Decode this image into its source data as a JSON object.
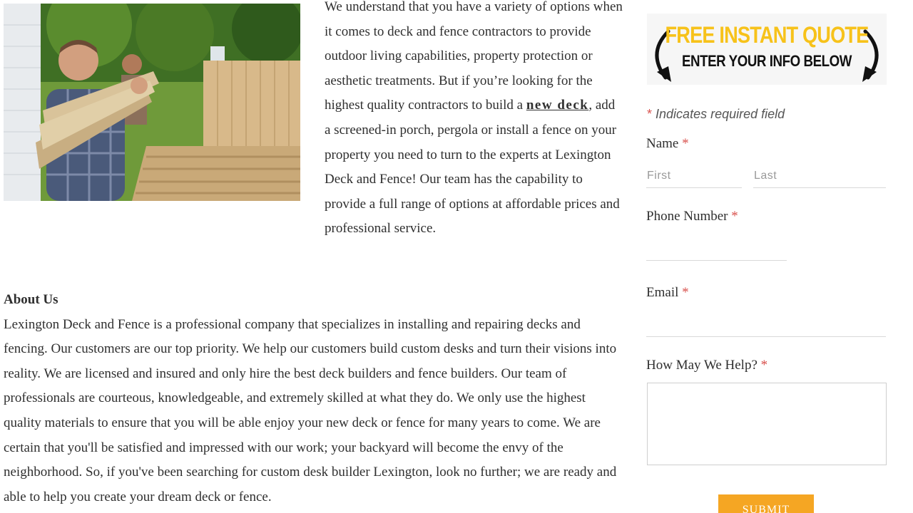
{
  "photo": {
    "alt": "Two carpenters carrying wooden planks in a backyard"
  },
  "intro": {
    "text_before_link": "We understand that you have a variety of options when it comes to deck and fence contractors to provide outdoor living capabilities, property protection or aesthetic treatments. But if you’re looking for the highest quality contractors to build a ",
    "link_text": "new deck",
    "text_after_link": ", add a screened-in porch, pergola or install a fence on your property you need to turn to the experts at Lexington Deck and Fence! Our team has the capability to provide a full range of options at affordable prices and professional service."
  },
  "about": {
    "heading": "About Us",
    "body": "Lexington Deck and Fence is a professional company that specializes in installing and repairing decks and fencing. Our customers are our top priority. We help our customers build custom desks and turn their visions into reality. We are licensed and insured and only hire the best deck builders and fence builders. Our team of professionals are courteous, knowledgeable, and extremely skilled at what they do. We only use the highest quality materials to ensure that you will be able enjoy your new deck or fence for many years to come. We are certain that you'll be satisfied and impressed with our work; your backyard will become the envy of the neighborhood. So, if you've been searching for custom desk builder Lexington, look no further; we are ready and able to help you create your dream deck or fence."
  },
  "form": {
    "banner_title": "FREE INSTANT QUOTE",
    "banner_subtitle": "ENTER YOUR INFO BELOW",
    "required_star": "*",
    "required_note": "Indicates required field",
    "name_label": "Name",
    "first_placeholder": "First",
    "last_placeholder": "Last",
    "phone_label": "Phone Number",
    "email_label": "Email",
    "help_label": "How May We Help?",
    "submit_label": "SUBMIT"
  },
  "colors": {
    "banner_title": "#f7c21a",
    "required_star": "#d9534f",
    "submit_button": "#f5a623"
  }
}
